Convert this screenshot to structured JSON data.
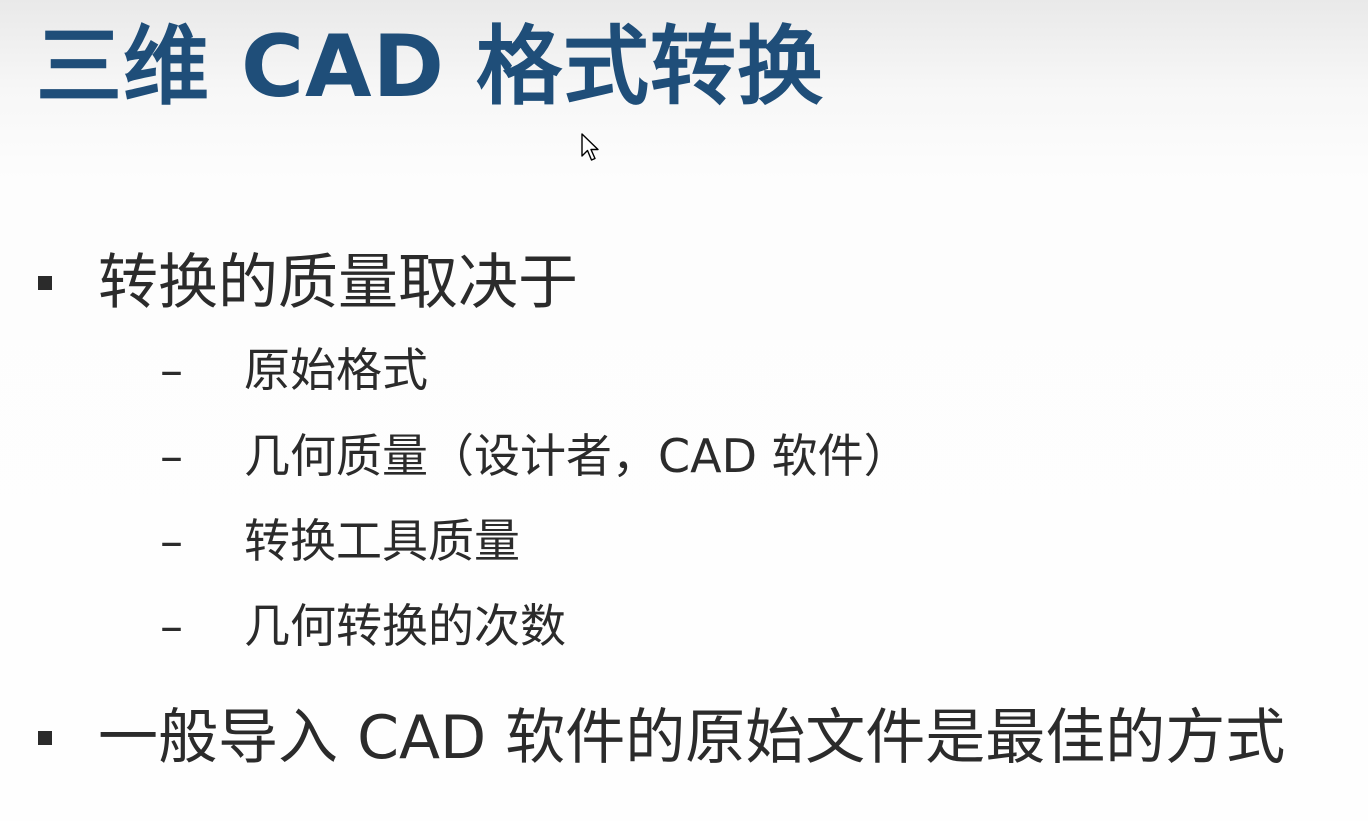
{
  "slide": {
    "title": "三维 CAD 格式转换",
    "bullets": [
      {
        "text": "转换的质量取决于",
        "subitems": [
          {
            "marker": "–",
            "text": "原始格式"
          },
          {
            "marker": "–",
            "text": "几何质量（设计者，CAD 软件）"
          },
          {
            "marker": "–",
            "text": "转换工具质量"
          },
          {
            "marker": "–",
            "text": "几何转换的次数"
          }
        ]
      },
      {
        "text": "一般导入 CAD 软件的原始文件是最佳的方式",
        "subitems": []
      }
    ]
  },
  "colors": {
    "title": "#1f4e79",
    "body_text": "#2b2b2b",
    "background": "#fefefe"
  },
  "icons": {
    "pointer": "mouse-pointer-icon"
  }
}
